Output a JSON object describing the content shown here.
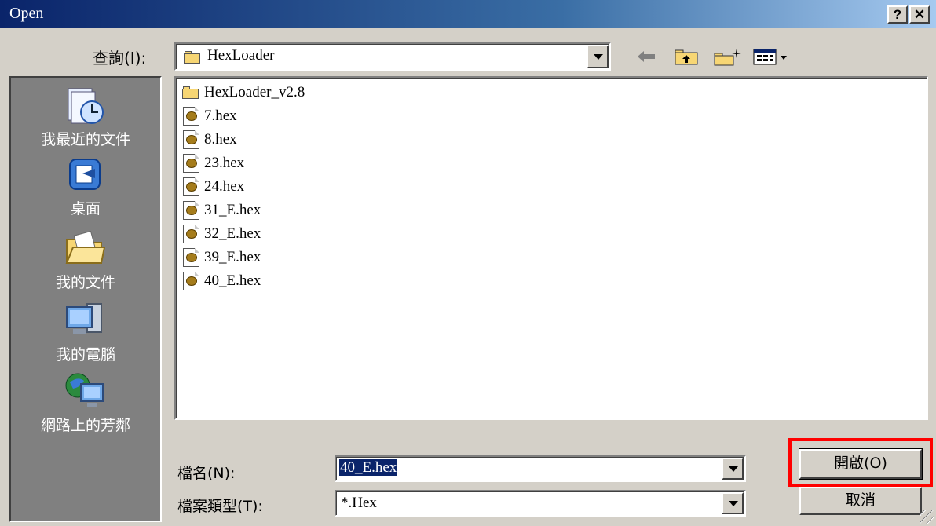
{
  "window": {
    "title": "Open",
    "help_glyph": "?",
    "close_glyph": "✕"
  },
  "look_in": {
    "label": "查詢(I):",
    "value": "HexLoader"
  },
  "places": [
    {
      "label": "我最近的文件",
      "icon": "recent-documents-icon"
    },
    {
      "label": "桌面",
      "icon": "desktop-icon"
    },
    {
      "label": "我的文件",
      "icon": "my-documents-icon"
    },
    {
      "label": "我的電腦",
      "icon": "my-computer-icon"
    },
    {
      "label": "網路上的芳鄰",
      "icon": "network-places-icon"
    }
  ],
  "files": [
    {
      "name": "HexLoader_v2.8",
      "type": "folder"
    },
    {
      "name": "7.hex",
      "type": "hex"
    },
    {
      "name": "8.hex",
      "type": "hex"
    },
    {
      "name": "23.hex",
      "type": "hex"
    },
    {
      "name": "24.hex",
      "type": "hex"
    },
    {
      "name": "31_E.hex",
      "type": "hex"
    },
    {
      "name": "32_E.hex",
      "type": "hex"
    },
    {
      "name": "39_E.hex",
      "type": "hex"
    },
    {
      "name": "40_E.hex",
      "type": "hex"
    }
  ],
  "filename": {
    "label": "檔名(N):",
    "value": "40_E.hex"
  },
  "filetype": {
    "label": "檔案類型(T):",
    "value": "*.Hex"
  },
  "buttons": {
    "open": "開啟(O)",
    "cancel": "取消"
  },
  "colors": {
    "titlebar_start": "#0a246a",
    "highlight_box": "#ff0000",
    "selection": "#0a246a"
  }
}
